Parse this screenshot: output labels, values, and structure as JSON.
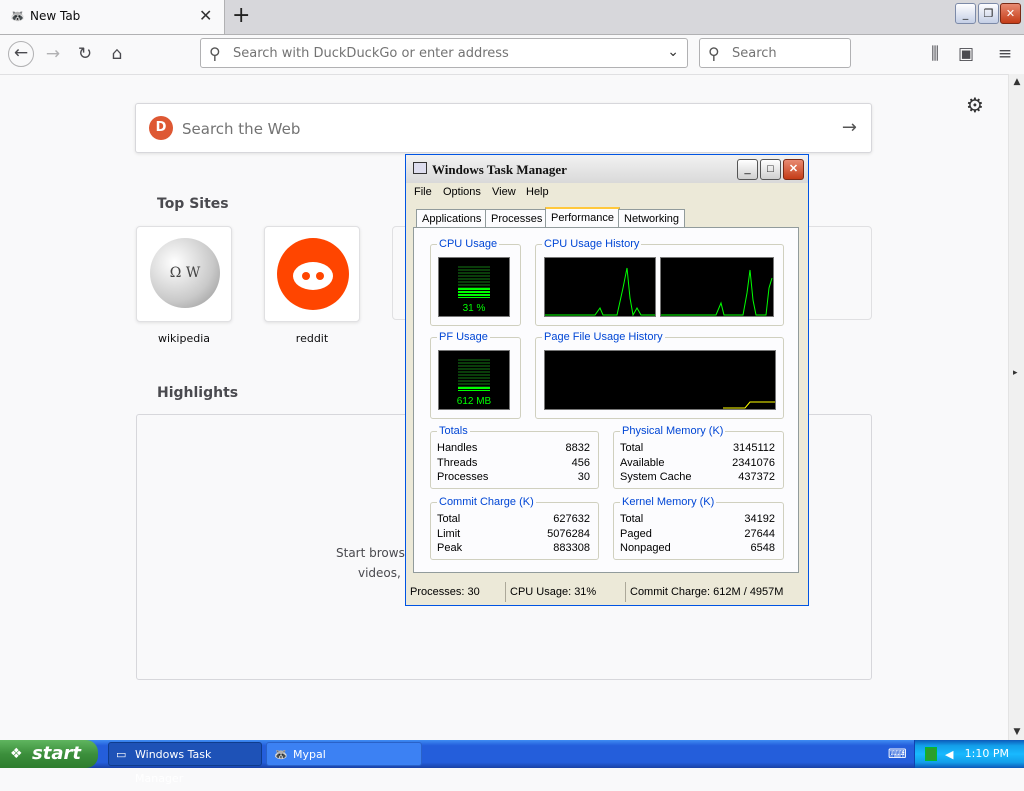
{
  "browser": {
    "tab_title": "New Tab",
    "tab_close": "✕",
    "new_tab": "+",
    "url_placeholder": "Search with DuckDuckGo or enter address",
    "search_placeholder": "Search"
  },
  "newtab": {
    "web_search_placeholder": "Search the Web",
    "top_sites_title": "Top Sites",
    "top_sites": [
      {
        "label": "wikipedia"
      },
      {
        "label": "reddit"
      }
    ],
    "highlights_title": "Highlights",
    "highlights_text_1": "Start browsi",
    "highlights_text_2": "videos, a"
  },
  "taskmanager": {
    "title": "Windows Task Manager",
    "menu": [
      "File",
      "Options",
      "View",
      "Help"
    ],
    "tabs": [
      "Applications",
      "Processes",
      "Performance",
      "Networking"
    ],
    "active_tab": "Performance",
    "cpu_usage_title": "CPU Usage",
    "cpu_usage_value": "31 %",
    "cpu_usage_fraction": 0.31,
    "cpu_history_title": "CPU Usage History",
    "pf_usage_title": "PF Usage",
    "pf_usage_value": "612 MB",
    "pf_usage_fraction": 0.12,
    "pf_history_title": "Page File Usage History",
    "totals": {
      "title": "Totals",
      "rows": [
        {
          "k": "Handles",
          "v": "8832"
        },
        {
          "k": "Threads",
          "v": "456"
        },
        {
          "k": "Processes",
          "v": "30"
        }
      ]
    },
    "physical": {
      "title": "Physical Memory (K)",
      "rows": [
        {
          "k": "Total",
          "v": "3145112"
        },
        {
          "k": "Available",
          "v": "2341076"
        },
        {
          "k": "System Cache",
          "v": "437372"
        }
      ]
    },
    "commit": {
      "title": "Commit Charge (K)",
      "rows": [
        {
          "k": "Total",
          "v": "627632"
        },
        {
          "k": "Limit",
          "v": "5076284"
        },
        {
          "k": "Peak",
          "v": "883308"
        }
      ]
    },
    "kernel": {
      "title": "Kernel Memory (K)",
      "rows": [
        {
          "k": "Total",
          "v": "34192"
        },
        {
          "k": "Paged",
          "v": "27644"
        },
        {
          "k": "Nonpaged",
          "v": "6548"
        }
      ]
    },
    "status": {
      "processes": "Processes: 30",
      "cpu": "CPU Usage: 31%",
      "commit": "Commit Charge: 612M / 4957M"
    }
  },
  "taskbar": {
    "start_label": "start",
    "buttons": [
      {
        "label": "Windows Task Manager",
        "active": true
      },
      {
        "label": "Mypal",
        "active": false
      }
    ],
    "clock": "1:10 PM"
  }
}
